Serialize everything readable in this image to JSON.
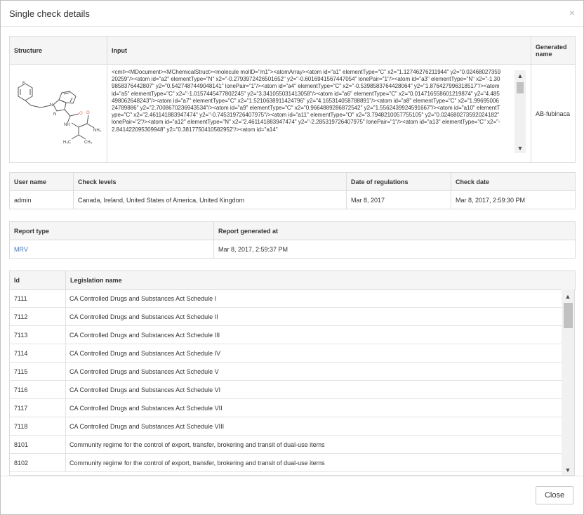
{
  "dialog": {
    "title": "Single check details",
    "close_icon": "×",
    "close_button": "Close"
  },
  "structure_table": {
    "headers": {
      "structure": "Structure",
      "input": "Input",
      "generated_name": "Generated name"
    },
    "input_text": "<cml><MDocument><MChemicalStruct><molecule molID=\"m1\"><atomArray><atom id=\"a1\" elementType=\"C\" x2=\"1.12746276211944\" y2=\"0.0246802735920259\"/><atom id=\"a2\" elementType=\"N\" x2=\"-0.2793972426501652\" y2=\"-0.6016941567447054\" lonePair=\"1\"/><atom id=\"a3\" elementType=\"N\" x2=\"-1.309858376442807\" y2=\"0.5427487449048141\" lonePair=\"1\"/><atom id=\"a4\" elementType=\"C\" x2=\"-0.5398583764428064\" y2=\"1.876427996318517\"/><atom id=\"a5\" elementType=\"C\" x2=\"-1.0157445477802245\" y2=\"3.341055031413058\"/><atom id=\"a6\" elementType=\"C\" x2=\"0.014716558601219874\" y2=\"4.485498062648243\"/><atom id=\"a7\" elementType=\"C\" x2=\"1.5210638911424796\" y2=\"4.165314058788891\"/><atom id=\"a8\" elementType=\"C\" x2=\"1.9969500624789886\" y2=\"2.7008670236943534\"/><atom id=\"a9\" elementType=\"C\" x2=\"0.9664889286872542\" y2=\"1.5562439924591667\"/><atom id=\"a10\" elementType=\"C\" x2=\"2.461141883947474\" y2=\"-0.745319726407975\"/><atom id=\"a11\" elementType=\"O\" x2=\"3.7948210057755105\" y2=\"0.024680273592024182\" lonePair=\"2\"/><atom id=\"a12\" elementType=\"N\" x2=\"2.461141883947474\" y2=\"-2.285319726407975\" lonePair=\"1\"/><atom id=\"a13\" elementType=\"C\" x2=\"-2.841422095309948\" y2=\"0.3817750410582952\"/><atom id=\"a14\"",
    "generated_name": "AB-fubinaca",
    "atom_labels": {
      "fluorine": "F",
      "n1": "N",
      "n2": "N",
      "oxygen": "O",
      "nh": "NH",
      "nh2": "NH₂",
      "h3c": "H₃C",
      "ch3": "CH₃"
    }
  },
  "user_table": {
    "headers": {
      "user": "User name",
      "levels": "Check levels",
      "date_reg": "Date of regulations",
      "check_date": "Check date"
    },
    "row": {
      "user": "admin",
      "levels": "Canada, Ireland, United States of America, United Kingdom",
      "date_reg": "Mar 8, 2017",
      "check_date": "Mar 8, 2017, 2:59:30 PM"
    }
  },
  "report_table": {
    "headers": {
      "type": "Report type",
      "generated": "Report generated at"
    },
    "row": {
      "type": "MRV",
      "generated": "Mar 8, 2017, 2:59:37 PM"
    }
  },
  "legislation_table": {
    "headers": {
      "id": "Id",
      "name": "Legislation name"
    },
    "rows": [
      {
        "id": "7111",
        "name": "CA Controlled Drugs and Substances Act Schedule I"
      },
      {
        "id": "7112",
        "name": "CA Controlled Drugs and Substances Act Schedule II"
      },
      {
        "id": "7113",
        "name": "CA Controlled Drugs and Substances Act Schedule III"
      },
      {
        "id": "7114",
        "name": "CA Controlled Drugs and Substances Act Schedule IV"
      },
      {
        "id": "7115",
        "name": "CA Controlled Drugs and Substances Act Schedule V"
      },
      {
        "id": "7116",
        "name": "CA Controlled Drugs and Substances Act Schedule VI"
      },
      {
        "id": "7117",
        "name": "CA Controlled Drugs and Substances Act Schedule VII"
      },
      {
        "id": "7118",
        "name": "CA Controlled Drugs and Substances Act Schedule VIII"
      },
      {
        "id": "8101",
        "name": "Community regime for the control of export, transfer, brokering and transit of dual-use items"
      },
      {
        "id": "8102",
        "name": "Community regime for the control of export, transfer, brokering and transit of dual-use items"
      }
    ]
  },
  "colors": {
    "link": "#3c7ac7",
    "header_bg": "#f5f5f5",
    "border": "#dcdcdc",
    "oxygen": "#e06040"
  }
}
